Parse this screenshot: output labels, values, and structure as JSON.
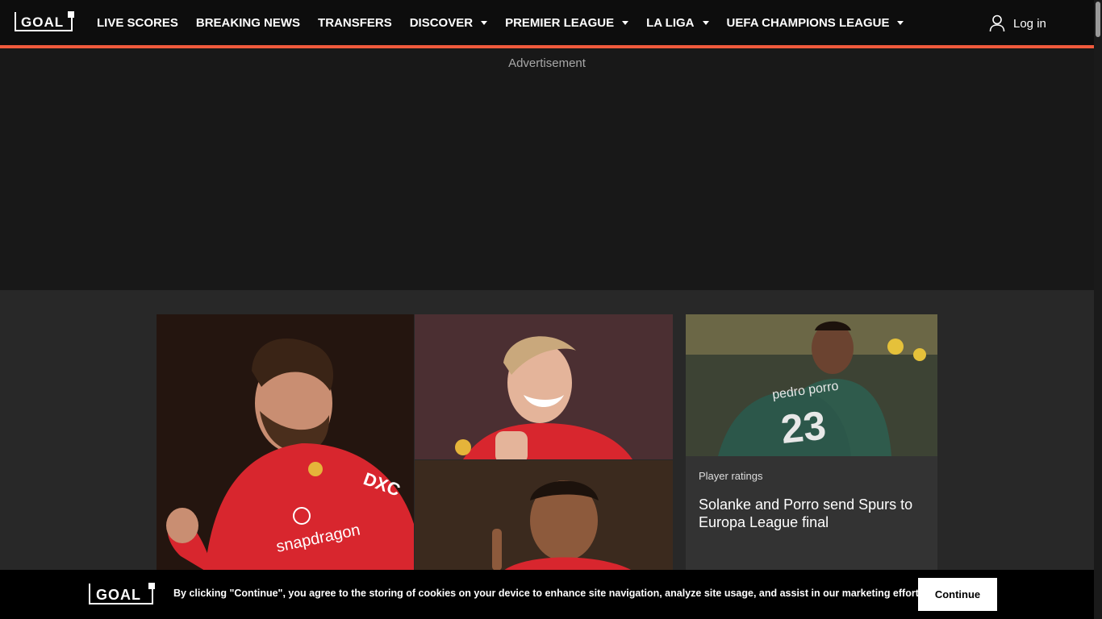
{
  "header": {
    "logo_text": "GOAL",
    "nav": [
      {
        "label": "LIVE SCORES",
        "dropdown": false
      },
      {
        "label": "BREAKING NEWS",
        "dropdown": false
      },
      {
        "label": "TRANSFERS",
        "dropdown": false
      },
      {
        "label": "DISCOVER",
        "dropdown": true
      },
      {
        "label": "PREMIER LEAGUE",
        "dropdown": true
      },
      {
        "label": "LA LIGA",
        "dropdown": true
      },
      {
        "label": "UEFA CHAMPIONS LEAGUE",
        "dropdown": true
      }
    ],
    "login_label": "Log in",
    "accent_color": "#f05a3c"
  },
  "ad": {
    "label": "Advertisement"
  },
  "hero": {
    "photo_left": "player in red kit with tongue out, clenched fist",
    "photo_top_right": "laughing blond player in red kit",
    "photo_bottom_right": "player pointing finger up"
  },
  "card": {
    "tag": "Player ratings",
    "title": "Solanke and Porro send Spurs to Europa League final",
    "image_jersey_name": "pedro porro",
    "image_jersey_number": "23"
  },
  "cookie": {
    "logo_text": "GOAL",
    "message": "By clicking \"Continue\", you agree to the storing of cookies on your device to enhance site navigation, analyze site usage, and assist in our marketing efforts.",
    "button_label": "Continue"
  },
  "icons": [
    "user-icon",
    "caret-down-icon"
  ]
}
